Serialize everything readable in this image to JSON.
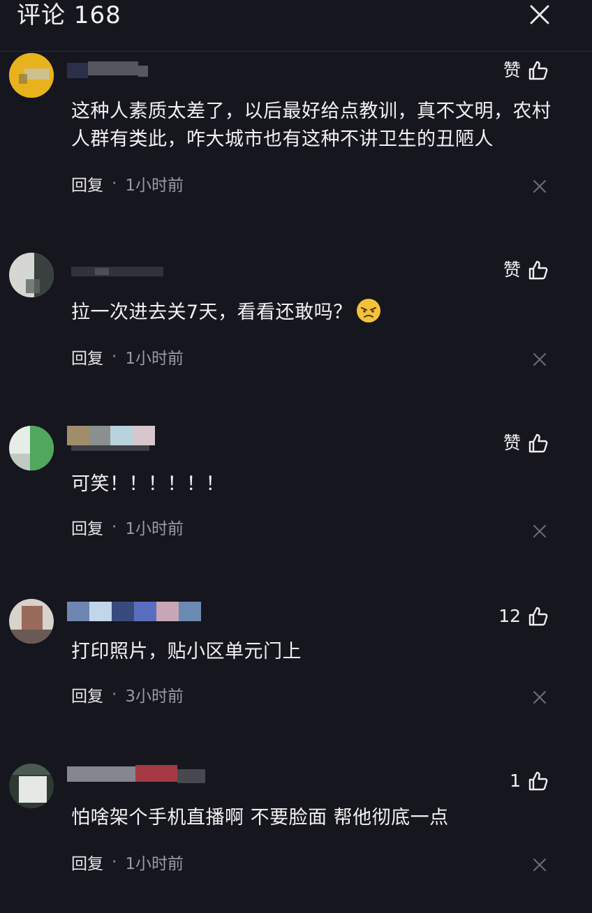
{
  "header": {
    "title": "评论 168",
    "close_icon": "close-icon"
  },
  "comments": [
    {
      "like_label": "赞",
      "text": "这种人素质太差了，以后最好给点教训，真不文明，农村人群有类此，咋大城市也有这种不讲卫生的丑陋人",
      "reply_label": "回复",
      "separator": "·",
      "time": "1小时前"
    },
    {
      "like_label": "赞",
      "text": "拉一次进去关7天，看看还敢吗？",
      "emoji": "angry-face-emoji",
      "reply_label": "回复",
      "separator": "·",
      "time": "1小时前"
    },
    {
      "like_label": "赞",
      "text": "可笑！！！！！！",
      "reply_label": "回复",
      "separator": "·",
      "time": "1小时前"
    },
    {
      "like_label": "12",
      "text": "打印照片，贴小区单元门上",
      "reply_label": "回复",
      "separator": "·",
      "time": "3小时前"
    },
    {
      "like_label": "1",
      "text": "怕啥架个手机直播啊 不要脸面 帮他彻底一点",
      "reply_label": "回复",
      "separator": "·",
      "time": "1小时前"
    }
  ],
  "colors": {
    "background": "#16161e",
    "text": "#f2f2f4",
    "muted": "#9a9aa4",
    "divider": "#2c2c36"
  },
  "icons": {
    "like": "thumbs-up-icon",
    "dismiss": "close-icon",
    "avatar": "avatar"
  }
}
